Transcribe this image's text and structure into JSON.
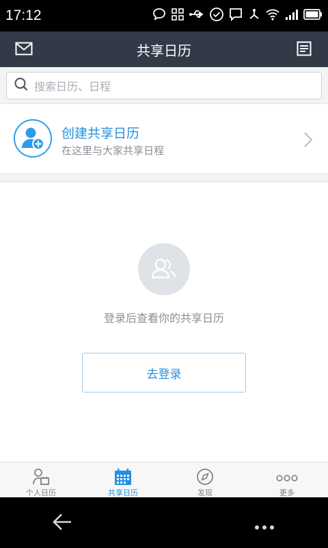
{
  "status_bar": {
    "time": "17:12",
    "icons": [
      "chat-bubble-icon",
      "qr-icon",
      "usb-icon",
      "check-circle-icon",
      "message-icon",
      "share-icon",
      "wifi-icon",
      "signal-icon",
      "battery-icon"
    ]
  },
  "header": {
    "title": "共享日历",
    "left_icon": "mail-icon",
    "right_icon": "notes-icon"
  },
  "search": {
    "placeholder": "搜索日历、日程"
  },
  "create_card": {
    "title": "创建共享日历",
    "subtitle": "在这里与大家共享日程"
  },
  "empty_state": {
    "message": "登录后查看你的共享日历",
    "button_label": "去登录"
  },
  "tabs": [
    {
      "label": "个人日历",
      "icon": "person-calendar-icon",
      "active": false
    },
    {
      "label": "共享日历",
      "icon": "calendar-grid-icon",
      "active": true
    },
    {
      "label": "发现",
      "icon": "compass-icon",
      "active": false
    },
    {
      "label": "更多",
      "icon": "more-dots-icon",
      "active": false
    }
  ],
  "colors": {
    "header_bg": "#323a48",
    "accent": "#2391e0",
    "text_secondary": "#8a8f96"
  }
}
